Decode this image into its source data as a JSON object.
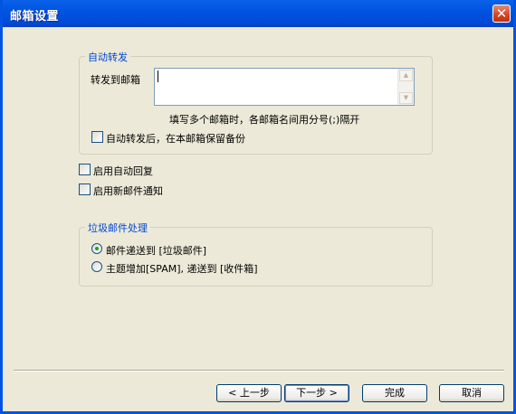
{
  "window": {
    "title": "邮箱设置",
    "close_glyph": "✕"
  },
  "auto_forward": {
    "legend": "自动转发",
    "forward_label": "转发到邮箱",
    "forward_value": "",
    "hint": "填写多个邮箱时，各邮箱名间用分号(;)隔开",
    "keep_copy_label": "自动转发后，在本邮箱保留备份",
    "keep_copy_checked": false
  },
  "options": [
    {
      "label": "启用自动回复",
      "checked": false
    },
    {
      "label": "启用新邮件通知",
      "checked": false
    }
  ],
  "spam": {
    "legend": "垃圾邮件处理",
    "choices": [
      {
        "label": "邮件递送到 [垃圾邮件]",
        "selected": true
      },
      {
        "label": "主题增加[SPAM], 递送到 [收件箱]",
        "selected": false
      }
    ]
  },
  "buttons": {
    "back": "< 上一步",
    "next": "下一步 >",
    "finish": "完成",
    "cancel": "取消"
  },
  "colors": {
    "titlebar": "#0054e3",
    "dialog_bg": "#ece9d8",
    "group_legend": "#0046d5",
    "radio_dot": "#21a121"
  }
}
